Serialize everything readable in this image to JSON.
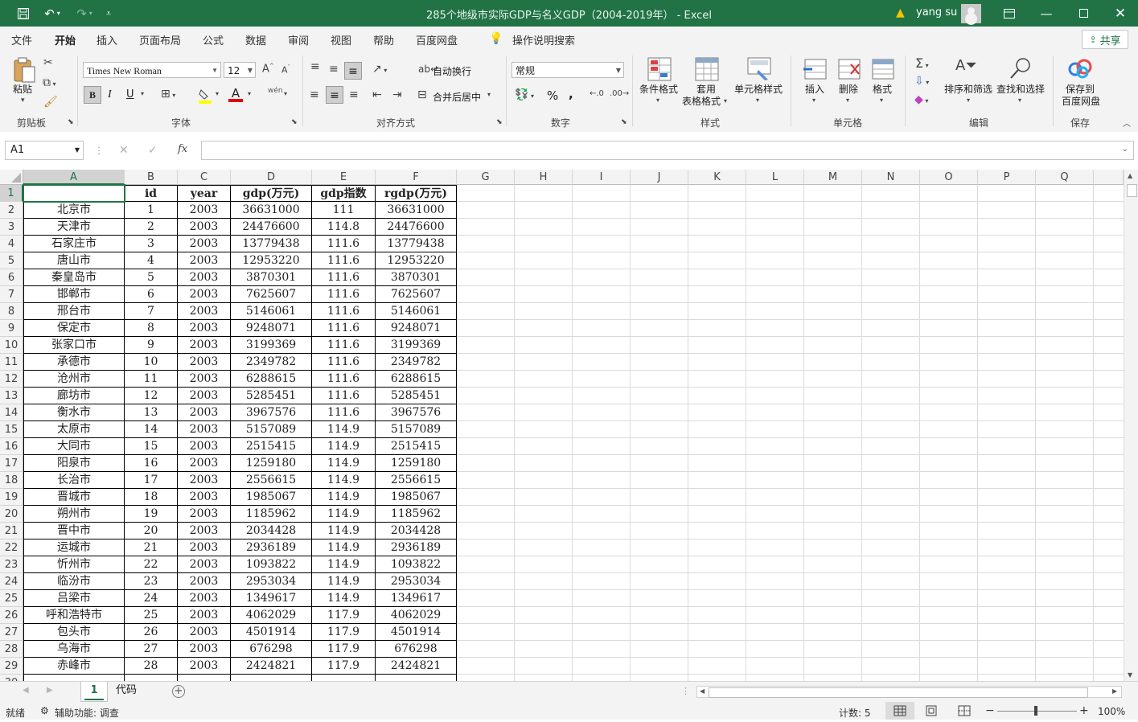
{
  "window": {
    "title": "285个地级市实际GDP与名义GDP（2004-2019年） - Excel",
    "user": "yang su",
    "warning_icon": "warning-icon"
  },
  "quick_access": {
    "save": "save-icon",
    "undo": "undo-icon",
    "redo": "redo-icon",
    "customize": "customize-icon"
  },
  "menu": {
    "tabs": [
      "文件",
      "开始",
      "插入",
      "页面布局",
      "公式",
      "数据",
      "审阅",
      "视图",
      "帮助",
      "百度网盘"
    ],
    "active": "开始",
    "tell_me": "操作说明搜索",
    "share": "共享"
  },
  "ribbon": {
    "clipboard": {
      "label": "剪贴板",
      "paste": "粘贴"
    },
    "font": {
      "label": "字体",
      "font_name": "Times New Roman",
      "font_size": "12",
      "bold": "B",
      "italic": "I",
      "underline": "U",
      "phonetic": "wén"
    },
    "alignment": {
      "label": "对齐方式",
      "wrap": "自动换行",
      "merge": "合并后居中"
    },
    "number": {
      "label": "数字",
      "format": "常规",
      "percent": "%",
      "comma": ","
    },
    "styles": {
      "label": "样式",
      "conditional": "条件格式",
      "table_1": "套用",
      "table_2": "表格格式",
      "cell_styles": "单元格样式"
    },
    "cells": {
      "label": "单元格",
      "insert": "插入",
      "delete": "删除",
      "format": "格式"
    },
    "editing": {
      "label": "编辑",
      "sort": "排序和筛选",
      "find": "查找和选择"
    },
    "save": {
      "label": "保存",
      "btn_1": "保存到",
      "btn_2": "百度网盘"
    }
  },
  "formula_bar": {
    "name_box": "A1",
    "fx": "fx",
    "value": ""
  },
  "columns": [
    "A",
    "B",
    "C",
    "D",
    "E",
    "F",
    "G",
    "H",
    "I",
    "J",
    "K",
    "L",
    "M",
    "N",
    "O",
    "P",
    "Q"
  ],
  "headers": [
    "",
    "id",
    "year",
    "gdp(万元)",
    "gdp指数",
    "rgdp(万元)"
  ],
  "rows": [
    [
      "北京市",
      "1",
      "2003",
      "36631000",
      "111",
      "36631000"
    ],
    [
      "天津市",
      "2",
      "2003",
      "24476600",
      "114.8",
      "24476600"
    ],
    [
      "石家庄市",
      "3",
      "2003",
      "13779438",
      "111.6",
      "13779438"
    ],
    [
      "唐山市",
      "4",
      "2003",
      "12953220",
      "111.6",
      "12953220"
    ],
    [
      "秦皇岛市",
      "5",
      "2003",
      "3870301",
      "111.6",
      "3870301"
    ],
    [
      "邯郸市",
      "6",
      "2003",
      "7625607",
      "111.6",
      "7625607"
    ],
    [
      "邢台市",
      "7",
      "2003",
      "5146061",
      "111.6",
      "5146061"
    ],
    [
      "保定市",
      "8",
      "2003",
      "9248071",
      "111.6",
      "9248071"
    ],
    [
      "张家口市",
      "9",
      "2003",
      "3199369",
      "111.6",
      "3199369"
    ],
    [
      "承德市",
      "10",
      "2003",
      "2349782",
      "111.6",
      "2349782"
    ],
    [
      "沧州市",
      "11",
      "2003",
      "6288615",
      "111.6",
      "6288615"
    ],
    [
      "廊坊市",
      "12",
      "2003",
      "5285451",
      "111.6",
      "5285451"
    ],
    [
      "衡水市",
      "13",
      "2003",
      "3967576",
      "111.6",
      "3967576"
    ],
    [
      "太原市",
      "14",
      "2003",
      "5157089",
      "114.9",
      "5157089"
    ],
    [
      "大同市",
      "15",
      "2003",
      "2515415",
      "114.9",
      "2515415"
    ],
    [
      "阳泉市",
      "16",
      "2003",
      "1259180",
      "114.9",
      "1259180"
    ],
    [
      "长治市",
      "17",
      "2003",
      "2556615",
      "114.9",
      "2556615"
    ],
    [
      "晋城市",
      "18",
      "2003",
      "1985067",
      "114.9",
      "1985067"
    ],
    [
      "朔州市",
      "19",
      "2003",
      "1185962",
      "114.9",
      "1185962"
    ],
    [
      "晋中市",
      "20",
      "2003",
      "2034428",
      "114.9",
      "2034428"
    ],
    [
      "运城市",
      "21",
      "2003",
      "2936189",
      "114.9",
      "2936189"
    ],
    [
      "忻州市",
      "22",
      "2003",
      "1093822",
      "114.9",
      "1093822"
    ],
    [
      "临汾市",
      "23",
      "2003",
      "2953034",
      "114.9",
      "2953034"
    ],
    [
      "吕梁市",
      "24",
      "2003",
      "1349617",
      "114.9",
      "1349617"
    ],
    [
      "呼和浩特市",
      "25",
      "2003",
      "4062029",
      "117.9",
      "4062029"
    ],
    [
      "包头市",
      "26",
      "2003",
      "4501914",
      "117.9",
      "4501914"
    ],
    [
      "乌海市",
      "27",
      "2003",
      "676298",
      "117.9",
      "676298"
    ],
    [
      "赤峰市",
      "28",
      "2003",
      "2424821",
      "117.9",
      "2424821"
    ]
  ],
  "sheets": {
    "tabs": [
      "1",
      "代码"
    ],
    "active": "1"
  },
  "status": {
    "ready": "就绪",
    "accessibility": "辅助功能: 调查",
    "count": "计数: 5",
    "zoom": "100%",
    "minus": "−",
    "plus": "+"
  },
  "colors": {
    "brand": "#217346",
    "ribbon_bg": "#f3f3f3",
    "font_color_bar": "#e00000",
    "highlight_bar": "#ffff00"
  }
}
